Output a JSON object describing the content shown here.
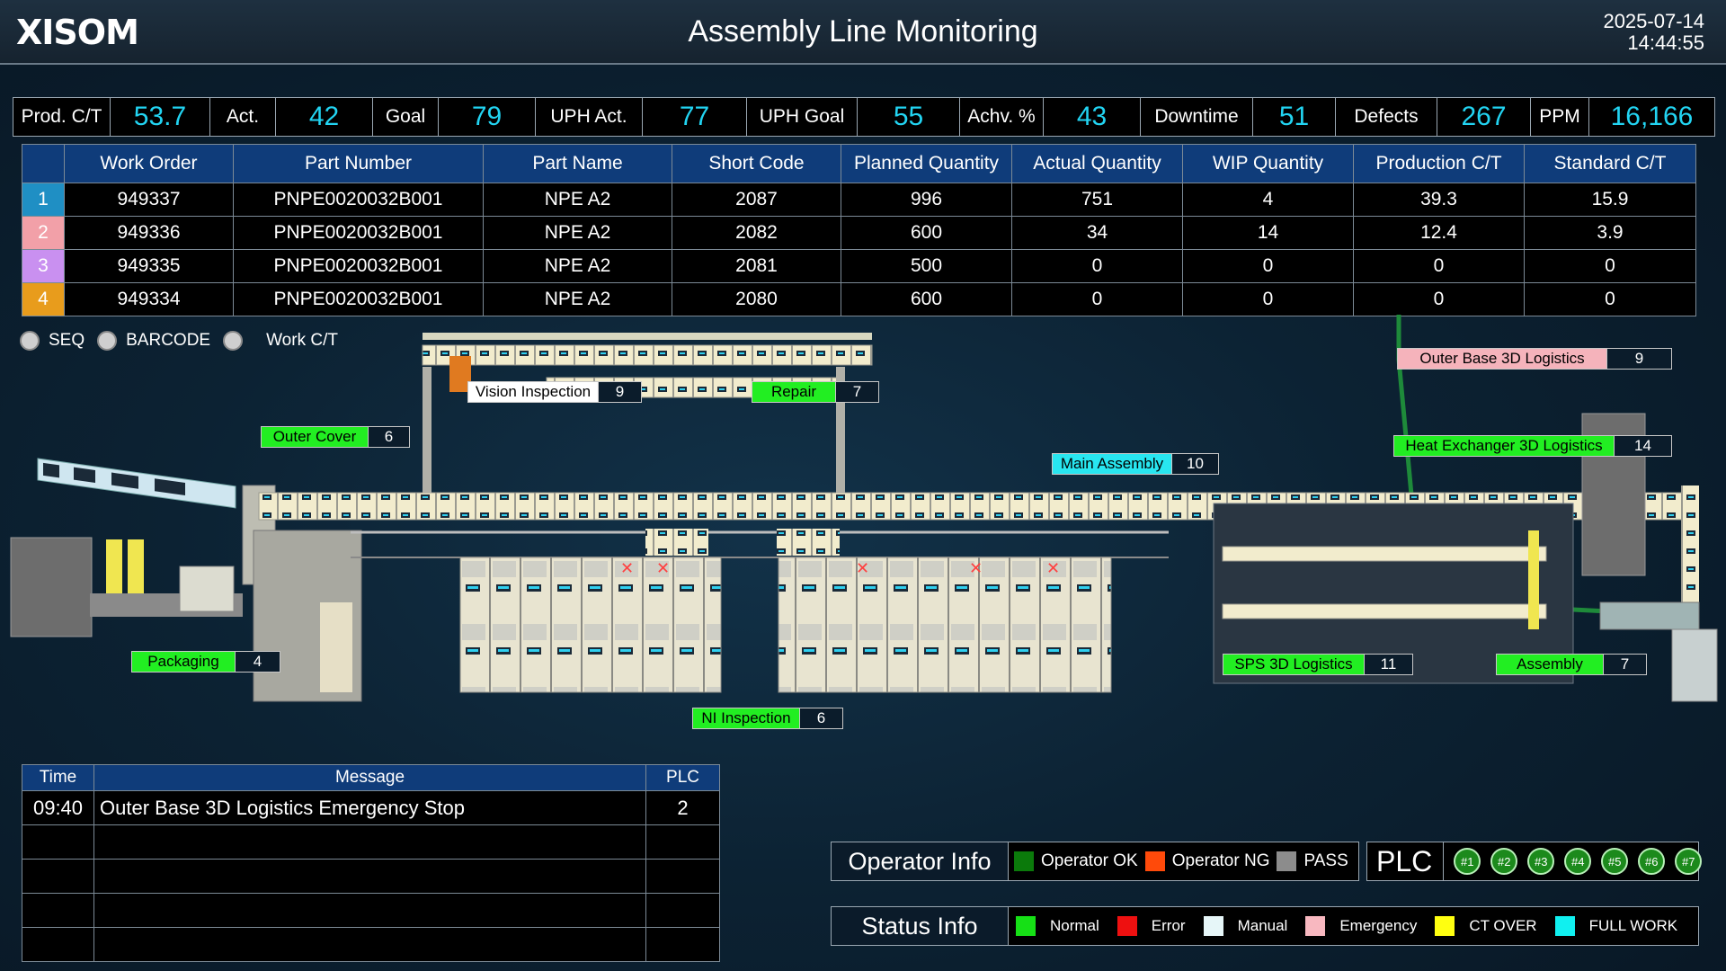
{
  "header": {
    "logo": "XISOM",
    "title": "Assembly Line Monitoring",
    "date": "2025-07-14",
    "time": "14:44:55"
  },
  "kpis": [
    {
      "label": "Prod. C/T",
      "value": "53.7"
    },
    {
      "label": "Act.",
      "value": "42"
    },
    {
      "label": "Goal",
      "value": "79"
    },
    {
      "label": "UPH Act.",
      "value": "77"
    },
    {
      "label": "UPH Goal",
      "value": "55"
    },
    {
      "label": "Achv. %",
      "value": "43"
    },
    {
      "label": "Downtime",
      "value": "51"
    },
    {
      "label": "Defects",
      "value": "267"
    },
    {
      "label": "PPM",
      "value": "16,166"
    }
  ],
  "work_orders": {
    "columns": [
      "",
      "Work Order",
      "Part Number",
      "Part Name",
      "Short Code",
      "Planned Quantity",
      "Actual Quantity",
      "WIP Quantity",
      "Production C/T",
      "Standard C/T"
    ],
    "rows": [
      {
        "idx": "1",
        "color": "#1f8fc4",
        "cells": [
          "949337",
          "PNPE0020032B001",
          "NPE A2",
          "2087",
          "996",
          "751",
          "4",
          "39.3",
          "15.9"
        ]
      },
      {
        "idx": "2",
        "color": "#f2a0a8",
        "cells": [
          "949336",
          "PNPE0020032B001",
          "NPE A2",
          "2082",
          "600",
          "34",
          "14",
          "12.4",
          "3.9"
        ]
      },
      {
        "idx": "3",
        "color": "#c990f0",
        "cells": [
          "949335",
          "PNPE0020032B001",
          "NPE A2",
          "2081",
          "500",
          "0",
          "0",
          "0",
          "0"
        ]
      },
      {
        "idx": "4",
        "color": "#e89c1c",
        "cells": [
          "949334",
          "PNPE0020032B001",
          "NPE A2",
          "2080",
          "600",
          "0",
          "0",
          "0",
          "0"
        ]
      }
    ]
  },
  "view_options": [
    "SEQ",
    "BARCODE",
    "Work C/T"
  ],
  "stations": [
    {
      "name": "Vision Inspection",
      "count": "9",
      "color": "#ffffff"
    },
    {
      "name": "Repair",
      "count": "7",
      "color": "#22ee22"
    },
    {
      "name": "Outer Cover",
      "count": "6",
      "color": "#22ee22"
    },
    {
      "name": "Main Assembly",
      "count": "10",
      "color": "#28e6f0"
    },
    {
      "name": "Outer Base 3D Logistics",
      "count": "9",
      "color": "#f5b3bb"
    },
    {
      "name": "Heat Exchanger 3D Logistics",
      "count": "14",
      "color": "#22ee22"
    },
    {
      "name": "Packaging",
      "count": "4",
      "color": "#22ee22"
    },
    {
      "name": "SPS 3D Logistics",
      "count": "11",
      "color": "#22ee22"
    },
    {
      "name": "Assembly",
      "count": "7",
      "color": "#22ee22"
    },
    {
      "name": "NI Inspection",
      "count": "6",
      "color": "#22ee22"
    }
  ],
  "messages": {
    "columns": [
      "Time",
      "Message",
      "PLC"
    ],
    "rows": [
      [
        "09:40",
        "Outer Base 3D Logistics Emergency Stop",
        "2"
      ],
      [
        "",
        "",
        ""
      ],
      [
        "",
        "",
        ""
      ],
      [
        "",
        "",
        ""
      ],
      [
        "",
        "",
        ""
      ]
    ]
  },
  "operator_info": {
    "title": "Operator Info",
    "items": [
      {
        "label": "Operator OK",
        "color": "#0b7a0b"
      },
      {
        "label": "Operator NG",
        "color": "#ff4a0a"
      },
      {
        "label": "PASS",
        "color": "#8c8c8c"
      }
    ]
  },
  "status_info": {
    "title": "Status Info",
    "items": [
      {
        "label": "Normal",
        "color": "#16e016"
      },
      {
        "label": "Error",
        "color": "#ee1010"
      },
      {
        "label": "Manual",
        "color": "#e6f6f8"
      },
      {
        "label": "Emergency",
        "color": "#f8b8c0"
      },
      {
        "label": "CT OVER",
        "color": "#ffff10"
      },
      {
        "label": "FULL WORK",
        "color": "#10f0f0"
      }
    ]
  },
  "plc": {
    "title": "PLC",
    "units": [
      "#1",
      "#2",
      "#3",
      "#4",
      "#5",
      "#6",
      "#7"
    ]
  }
}
